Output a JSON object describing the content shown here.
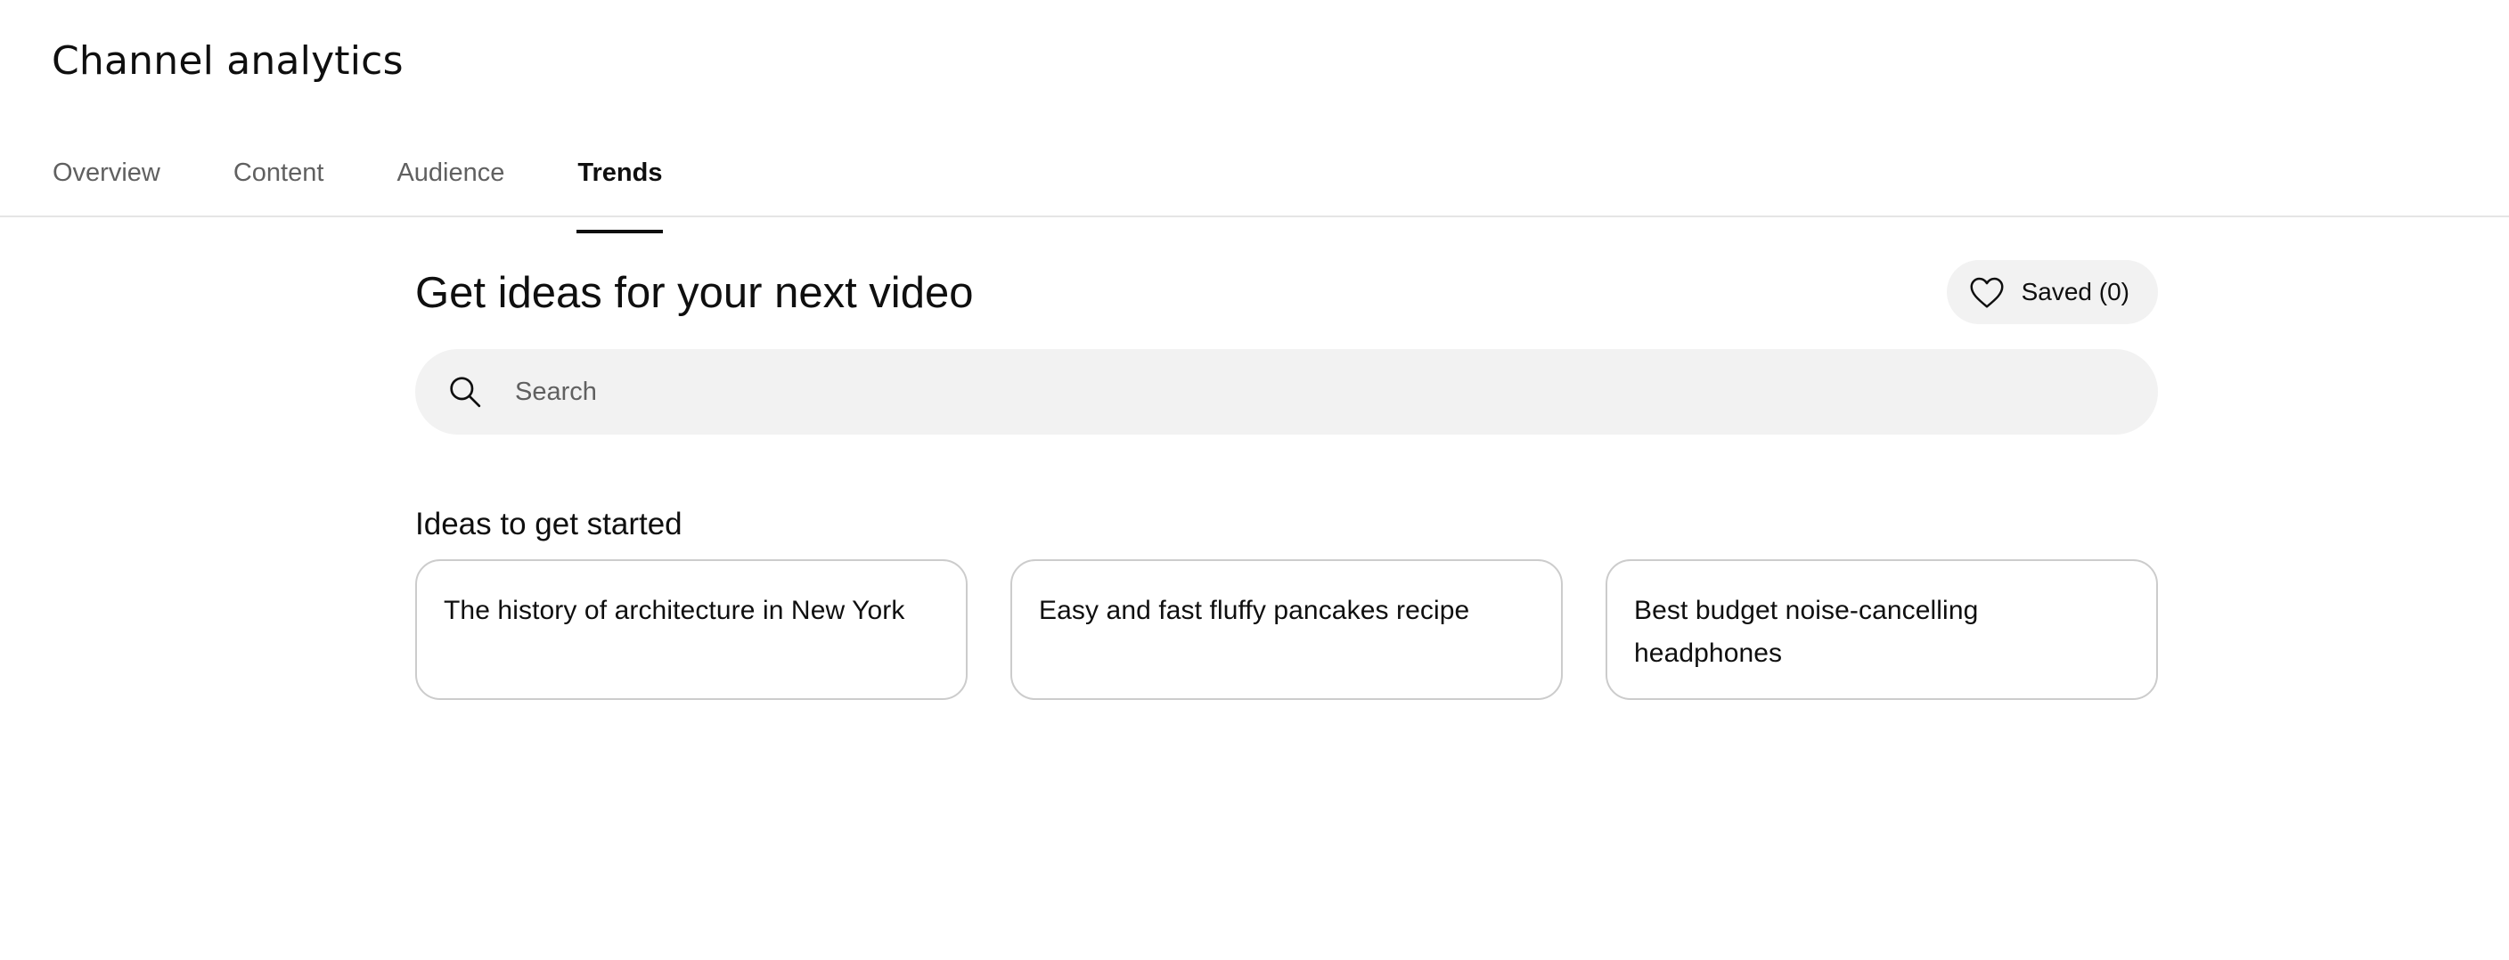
{
  "header": {
    "title": "Channel analytics",
    "tabs": [
      {
        "label": "Overview",
        "active": false
      },
      {
        "label": "Content",
        "active": false
      },
      {
        "label": "Audience",
        "active": false
      },
      {
        "label": "Trends",
        "active": true
      }
    ]
  },
  "main": {
    "headline": "Get ideas for your next video",
    "saved_button": {
      "label": "Saved (0)",
      "icon": "heart-outline-icon"
    },
    "search": {
      "placeholder": "Search",
      "value": "",
      "icon": "search-icon"
    },
    "ideas_section": {
      "title": "Ideas to get started",
      "cards": [
        {
          "label": "The history of architecture in New York"
        },
        {
          "label": "Easy and fast fluffy pancakes recipe"
        },
        {
          "label": "Best budget noise-cancelling headphones"
        }
      ]
    }
  },
  "colors": {
    "text_primary": "#0f0f0f",
    "text_secondary": "#606060",
    "chip_background": "#f2f2f2",
    "card_border": "#cccccc",
    "divider": "#e5e5e5"
  }
}
